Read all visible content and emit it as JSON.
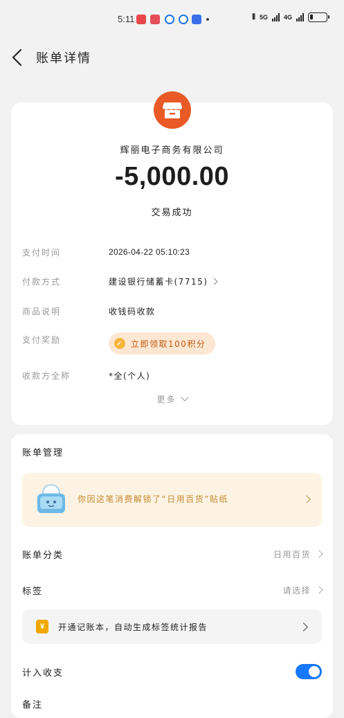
{
  "status_bar": {
    "time": "5:11",
    "net1": "5G",
    "net2": "4G",
    "battery_level": 0.2
  },
  "header": {
    "title": "账单详情"
  },
  "transaction": {
    "merchant_icon": "shop-icon",
    "merchant_name": "辉丽电子商务有限公司",
    "amount": "-5,000.00",
    "status": "交易成功",
    "accent_color": "#ea5a26"
  },
  "details": [
    {
      "label": "支付时间",
      "value": "2026-04-22 05:10:23"
    },
    {
      "label": "付款方式",
      "value": "建设银行储蓄卡(7715)"
    },
    {
      "label": "商品说明",
      "value": "收钱码收款"
    },
    {
      "label": "支付奖励",
      "value": "立即领取100积分"
    },
    {
      "label": "收款方全称",
      "value": "*全(个人)"
    }
  ],
  "more_label": "更多",
  "management": {
    "title": "账单管理",
    "sticker_text": "你因这笔消费解锁了“日用百货”贴纸",
    "category_label": "账单分类",
    "category_value": "日用百货",
    "tag_label": "标签",
    "tag_value": "请选择",
    "ledger_text": "开通记账本，自动生成标签统计报告",
    "count_label": "计入收支",
    "count_enabled": true,
    "note_label": "备注",
    "toggle_color": "#1677ff"
  }
}
